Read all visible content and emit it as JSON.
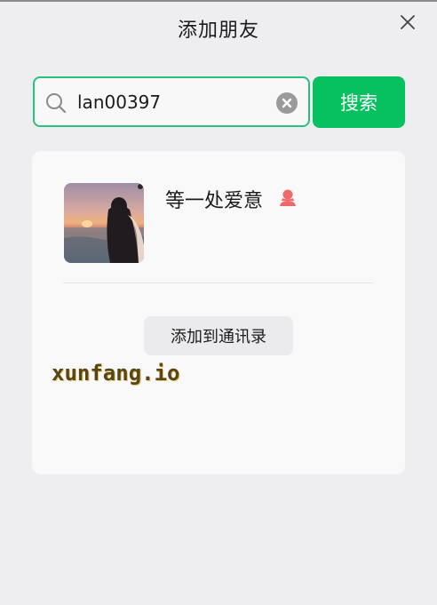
{
  "window": {
    "title": "添加朋友",
    "close_icon": "close-icon"
  },
  "search": {
    "value": "lan00397",
    "icon": "search-icon",
    "clear_icon": "clear-circle-icon",
    "button_label": "搜索",
    "accent_color": "#07c160"
  },
  "result": {
    "nickname": "等一处爱意",
    "gender_icon": "female-user-icon",
    "gender_color": "#f06a6a",
    "avatar_icon": "sunset-beach-avatar",
    "add_button_label": "添加到通讯录"
  },
  "watermark": {
    "text": "xunfang.io"
  }
}
